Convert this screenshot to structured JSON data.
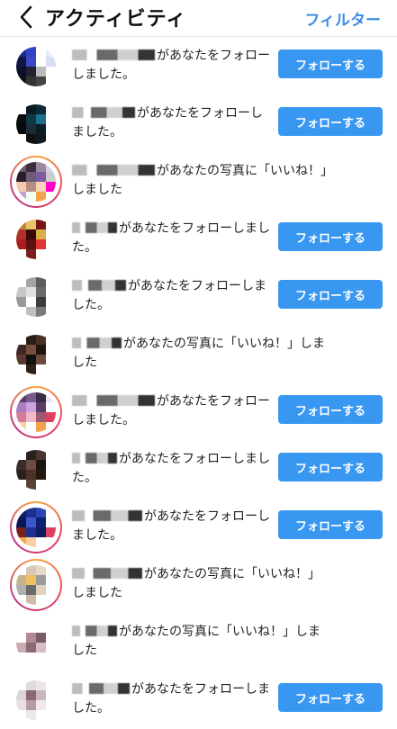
{
  "header": {
    "title": "アクティビティ",
    "filter_label": "フィルター"
  },
  "follow_label": "フォローする",
  "accent_color": "#3897f0",
  "items": [
    {
      "action": "があなたをフォローしました。",
      "has_button": true,
      "ring": false,
      "name_w": 92,
      "colors": [
        "#1d2b8f",
        "#2e46c5",
        "#ffffff",
        "#e8ecff",
        "#101848",
        "#3a49c9",
        "#ffffff",
        "#d9def5",
        "#0b0f2a",
        "#223",
        "#bbb",
        "#ffffff",
        "#111",
        "#333",
        "#444",
        "#ffffff"
      ]
    },
    {
      "action": "があなたをフォローしました。",
      "has_button": true,
      "ring": false,
      "name_w": 70,
      "colors": [
        "#ffffff",
        "#0a1a22",
        "#0f2a36",
        "#ffffff",
        "#0a0d10",
        "#0e3947",
        "#1b6f8a",
        "#ffffff",
        "#05080a",
        "#1a2c38",
        "#0c1c24",
        "#ffffff",
        "#ffffff",
        "#101010",
        "#0f1a20",
        "#ffffff"
      ]
    },
    {
      "action": "があなたの写真に「いいね！」しました",
      "has_button": false,
      "ring": true,
      "name_w": 92,
      "colors": [
        "#6a5a6e",
        "#3b2d3a",
        "#9a8aa0",
        "#d8cfe0",
        "#2a1e28",
        "#6e5b75",
        "#7d5ba0",
        "#ccc",
        "#f4c9a9",
        "#b58f86",
        "#fbd2b8",
        "#f0c",
        "#c4a0d9",
        "#efe",
        "#f6a44c",
        "#fff"
      ]
    },
    {
      "action": "があなたをフォローしました。",
      "has_button": true,
      "ring": false,
      "name_w": 50,
      "colors": [
        "#c28a2f",
        "#e7c46a",
        "#7a1414",
        "#ffffff",
        "#b0302c",
        "#3a0a0a",
        "#d8b04c",
        "#ffffff",
        "#a81d1d",
        "#5c1010",
        "#e03535",
        "#ffffff",
        "#ffffff",
        "#7a2020",
        "#ffffff",
        "#ffffff"
      ]
    },
    {
      "action": "があなたをフォローしました。",
      "has_button": true,
      "ring": false,
      "name_w": 60,
      "colors": [
        "#ffffff",
        "#a5a5a5",
        "#5e5e5e",
        "#ffffff",
        "#c8c8c8",
        "#e2e2e2",
        "#6a6a6a",
        "#ffffff",
        "#9a9a9a",
        "#fdfdfd",
        "#3c3c3c",
        "#ffffff",
        "#ffffff",
        "#c0c0c0",
        "#7a7a7a",
        "#ffffff"
      ]
    },
    {
      "action": "があなたの写真に「いいね！」しました",
      "has_button": false,
      "ring": false,
      "name_w": 55,
      "colors": [
        "#ffffff",
        "#2a1d18",
        "#4b3028",
        "#ffffff",
        "#3d2a22",
        "#7a4e3e",
        "#1e1410",
        "#ffffff",
        "#5a3a30",
        "#14100e",
        "#6b4b3f",
        "#ffffff",
        "#ffffff",
        "#2c2018",
        "#ffffff",
        "#ffffff"
      ]
    },
    {
      "action": "があなたをフォローしました。",
      "has_button": true,
      "ring": true,
      "name_w": 92,
      "colors": [
        "#5b3d6e",
        "#7b5a8c",
        "#3a2a44",
        "#e9e0f0",
        "#a97cc0",
        "#cda2dc",
        "#5a3c66",
        "#ffffff",
        "#d47b9a",
        "#f2b8c6",
        "#9c5a74",
        "#e0405f",
        "#fbd0a0",
        "#ffffff",
        "#f4a04c",
        "#ffffff"
      ]
    },
    {
      "action": "があなたをフォローしました。",
      "has_button": true,
      "ring": false,
      "name_w": 50,
      "colors": [
        "#ffffff",
        "#2a1f1c",
        "#4a3630",
        "#ffffff",
        "#3a2c28",
        "#6a4c42",
        "#1a1412",
        "#ffffff",
        "#2c201c",
        "#4c3228",
        "#24180f",
        "#ffffff",
        "#ffffff",
        "#5a4438",
        "#ffffff",
        "#ffffff"
      ]
    },
    {
      "action": "があなたをフォローしました。",
      "has_button": true,
      "ring": true,
      "name_w": 78,
      "colors": [
        "#0e1d6e",
        "#1a3090",
        "#2a44b6",
        "#ffffff",
        "#0a1658",
        "#3a56c8",
        "#102070",
        "#ffffff",
        "#7a2020",
        "#1d2f8c",
        "#0f1b60",
        "#e0405f",
        "#f6a44c",
        "#fbd0a0",
        "#ffffff",
        "#ffffff"
      ]
    },
    {
      "action": "があなたの写真に「いいね！」しました",
      "has_button": false,
      "ring": true,
      "name_w": 78,
      "colors": [
        "#ffffff",
        "#d9c8b8",
        "#e8d8c8",
        "#ffffff",
        "#c8b48a",
        "#f0c060",
        "#9a9a9a",
        "#ffffff",
        "#b0b0b0",
        "#6a6a6a",
        "#e0d0c0",
        "#ffffff",
        "#ffffff",
        "#ccbbaa",
        "#ffffff",
        "#ffffff"
      ]
    },
    {
      "action": "があなたの写真に「いいね！」しました",
      "has_button": false,
      "ring": false,
      "name_w": 50,
      "colors": [
        "#ffffff",
        "#ffffff",
        "#ffffff",
        "#ffffff",
        "#ffffff",
        "#b08a90",
        "#7a5a66",
        "#ffffff",
        "#c8aab0",
        "#8c6a74",
        "#d8bcc4",
        "#ffffff",
        "#ffffff",
        "#ffffff",
        "#ffffff",
        "#ffffff"
      ]
    },
    {
      "action": "があなたをフォローしました。",
      "has_button": true,
      "ring": false,
      "name_w": 64,
      "colors": [
        "#ffffff",
        "#e0dcdc",
        "#eae6e6",
        "#ffffff",
        "#dcd4d4",
        "#8a6a70",
        "#c9b8bc",
        "#ffffff",
        "#e8e0e2",
        "#b89aa2",
        "#f0eaec",
        "#ffffff",
        "#ffffff",
        "#ece8e8",
        "#ffffff",
        "#ffffff"
      ]
    }
  ]
}
